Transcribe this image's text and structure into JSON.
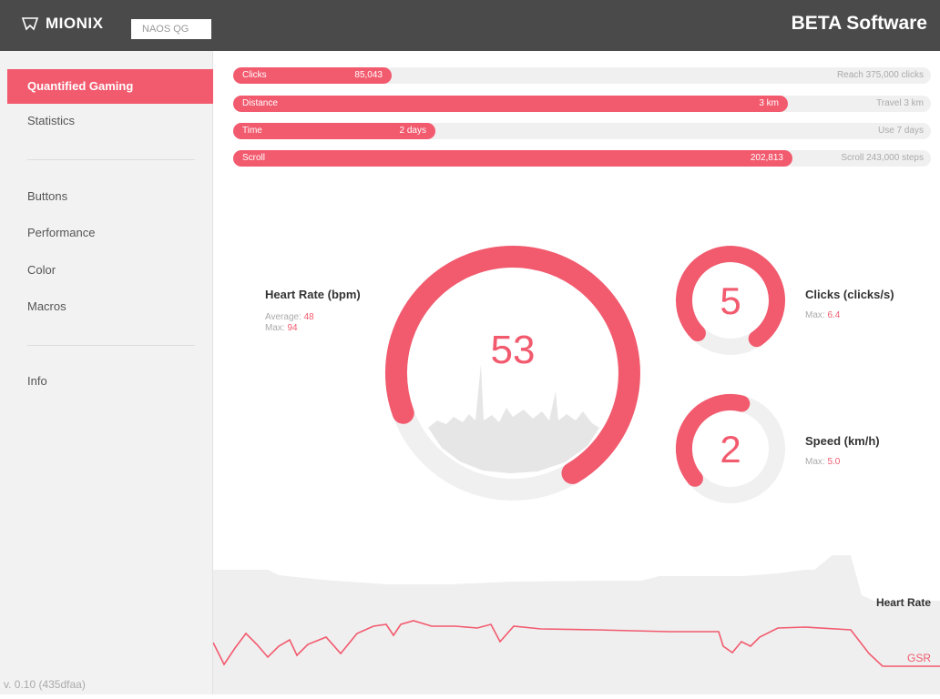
{
  "header": {
    "brand": "MIONIX",
    "device_tab": "NAOS QG",
    "beta_label": "BETA Software"
  },
  "sidebar": {
    "items": [
      {
        "label": "Quantified Gaming",
        "active": true
      },
      {
        "label": "Statistics"
      },
      {
        "label": "Buttons"
      },
      {
        "label": "Performance"
      },
      {
        "label": "Color"
      },
      {
        "label": "Macros"
      },
      {
        "label": "Info"
      }
    ],
    "version": "v. 0.10 (435dfaa)"
  },
  "progress": [
    {
      "label": "Clicks",
      "value": "85,043",
      "goal": "Reach 375,000 clicks",
      "fraction": 0.227
    },
    {
      "label": "Distance",
      "value": "3 km",
      "goal": "Travel 3 km",
      "fraction": 0.795
    },
    {
      "label": "Time",
      "value": "2 days",
      "goal": "Use 7 days",
      "fraction": 0.29
    },
    {
      "label": "Scroll",
      "value": "202,813",
      "goal": "Scroll 243,000 steps",
      "fraction": 0.802
    }
  ],
  "heart_rate": {
    "title": "Heart Rate (bpm)",
    "average_label": "Average:",
    "average_value": "48",
    "max_label": "Max:",
    "max_value": "94",
    "current": "53",
    "gauge_fraction": 0.72
  },
  "clicks_rate": {
    "title": "Clicks (clicks/s)",
    "max_label": "Max:",
    "max_value": "6.4",
    "current": "5",
    "gauge_fraction": 0.78
  },
  "speed": {
    "title": "Speed (km/h)",
    "max_label": "Max:",
    "max_value": "5.0",
    "current": "2",
    "gauge_fraction": 0.4
  },
  "bottom_chart": {
    "heart_rate_label": "Heart Rate",
    "gsr_label": "GSR"
  },
  "colors": {
    "accent": "#f25a6e",
    "topbar": "#4a4a4a",
    "sidebar": "#f2f2f2",
    "track": "#f0f0f0"
  }
}
